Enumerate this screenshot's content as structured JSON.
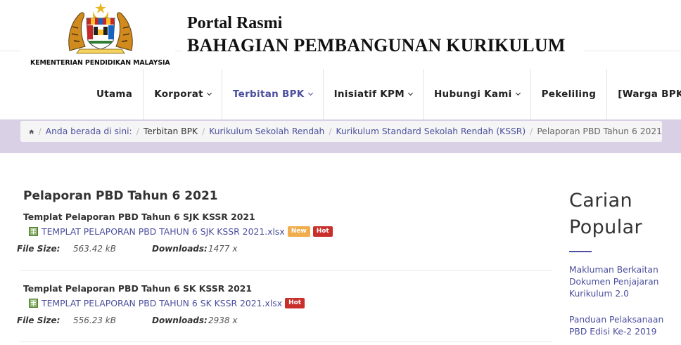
{
  "header": {
    "ministry": "KEMENTERIAN PENDIDIKAN MALAYSIA",
    "portal_line1": "Portal Rasmi",
    "portal_line2": "BAHAGIAN PEMBANGUNAN KURIKULUM"
  },
  "nav": {
    "items": [
      {
        "label": "Utama"
      },
      {
        "label": "Korporat"
      },
      {
        "label": "Terbitan BPK"
      },
      {
        "label": "Inisiatif KPM"
      },
      {
        "label": "Hubungi Kami"
      },
      {
        "label": "Pekeliling"
      },
      {
        "label": "[Warga BPK]"
      }
    ]
  },
  "breadcrumb": {
    "intro": "Anda berada di sini:",
    "items": [
      "Terbitan BPK",
      "Kurikulum Sekolah Rendah",
      "Kurikulum Standard Sekolah Rendah (KSSR)",
      "Pelaporan PBD Tahun 6 2021"
    ]
  },
  "main": {
    "title": "Pelaporan PBD Tahun 6 2021",
    "file_size_label": "File Size:",
    "downloads_label": "Downloads:",
    "docs": [
      {
        "title": "Templat Pelaporan PBD Tahun 6 SJK KSSR 2021",
        "file": "TEMPLAT PELAPORAN PBD TAHUN 6 SJK KSSR 2021.xlsx",
        "badges": [
          "New",
          "Hot"
        ],
        "size": "563.42 kB",
        "downloads": "1477 x"
      },
      {
        "title": "Templat Pelaporan PBD Tahun 6 SK KSSR 2021",
        "file": "TEMPLAT PELAPORAN PBD TAHUN 6 SK KSSR 2021.xlsx",
        "badges": [
          "Hot"
        ],
        "size": "556.23 kB",
        "downloads": "2938 x"
      }
    ]
  },
  "sidebar": {
    "title": "Carian Popular",
    "links": [
      "Makluman Berkaitan Dokumen Penjajaran Kurikulum 2.0",
      "Panduan Pelaksanaan PBD Edisi Ke-2 2019"
    ]
  },
  "icons": {
    "home": "home-icon",
    "file": "xlsx-file-icon",
    "dropdown": "chevron-down-icon"
  },
  "colors": {
    "accent": "#4b4f9e",
    "band": "#d9d0e6",
    "badge_new": "#f0ad4e",
    "badge_hot": "#c9302c"
  }
}
